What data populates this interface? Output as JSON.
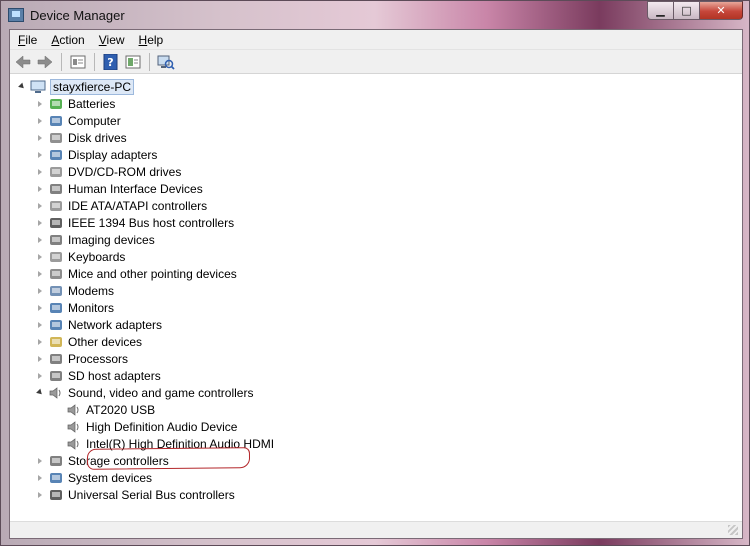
{
  "window": {
    "title": "Device Manager",
    "caption": {
      "minimize": "▁",
      "maximize": "□",
      "close": "✕"
    }
  },
  "menu": {
    "items": [
      {
        "key": "F",
        "rest": "ile"
      },
      {
        "key": "A",
        "rest": "ction"
      },
      {
        "key": "V",
        "rest": "iew"
      },
      {
        "key": "H",
        "rest": "elp"
      }
    ]
  },
  "toolbar": {
    "icons": [
      "back-icon",
      "forward-icon",
      "properties-icon",
      "help-icon",
      "update-driver-icon",
      "scan-hardware-icon"
    ]
  },
  "tree": {
    "root": "stayxfierce-PC",
    "categories": [
      {
        "label": "Batteries",
        "icon": "battery-icon",
        "color": "#3aa335"
      },
      {
        "label": "Computer",
        "icon": "computer-icon",
        "color": "#3b6ea8"
      },
      {
        "label": "Disk drives",
        "icon": "disk-drive-icon",
        "color": "#7d7d7d"
      },
      {
        "label": "Display adapters",
        "icon": "display-adapter-icon",
        "color": "#3b6ea8"
      },
      {
        "label": "DVD/CD-ROM drives",
        "icon": "dvd-drive-icon",
        "color": "#8a8a8a"
      },
      {
        "label": "Human Interface Devices",
        "icon": "hid-icon",
        "color": "#6a6a6a"
      },
      {
        "label": "IDE ATA/ATAPI controllers",
        "icon": "ide-controller-icon",
        "color": "#8a8a8a"
      },
      {
        "label": "IEEE 1394 Bus host controllers",
        "icon": "ieee1394-icon",
        "color": "#444444"
      },
      {
        "label": "Imaging devices",
        "icon": "camera-icon",
        "color": "#6a6a6a"
      },
      {
        "label": "Keyboards",
        "icon": "keyboard-icon",
        "color": "#8a8a8a"
      },
      {
        "label": "Mice and other pointing devices",
        "icon": "mouse-icon",
        "color": "#7a7a7a"
      },
      {
        "label": "Modems",
        "icon": "modem-icon",
        "color": "#5a7ea8"
      },
      {
        "label": "Monitors",
        "icon": "monitor-icon",
        "color": "#3b6ea8"
      },
      {
        "label": "Network adapters",
        "icon": "network-adapter-icon",
        "color": "#3b6ea8"
      },
      {
        "label": "Other devices",
        "icon": "other-devices-icon",
        "color": "#c9a93a"
      },
      {
        "label": "Processors",
        "icon": "processor-icon",
        "color": "#6a6a6a"
      },
      {
        "label": "SD host adapters",
        "icon": "sd-adapter-icon",
        "color": "#6a6a6a"
      }
    ],
    "expanded": {
      "label": "Sound, video and game controllers",
      "icon": "speaker-icon",
      "children": [
        {
          "label": "AT2020 USB"
        },
        {
          "label": "High Definition Audio Device"
        },
        {
          "label": "Intel(R) High Definition Audio HDMI"
        }
      ]
    },
    "categories_after": [
      {
        "label": "Storage controllers",
        "icon": "storage-controller-icon",
        "color": "#6a6a6a"
      },
      {
        "label": "System devices",
        "icon": "system-devices-icon",
        "color": "#3b6ea8"
      },
      {
        "label": "Universal Serial Bus controllers",
        "icon": "usb-icon",
        "color": "#444444"
      }
    ]
  }
}
